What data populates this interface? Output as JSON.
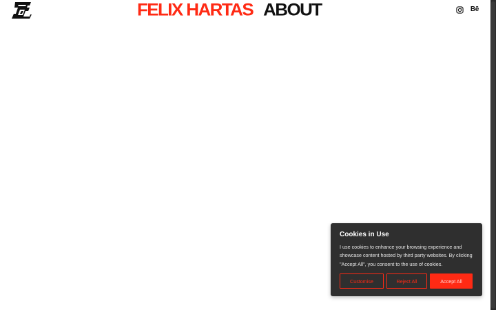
{
  "header": {
    "logo_icon": "fh-monogram-logo-icon",
    "nav": {
      "work_label": "FELIX HARTAS",
      "about_label": "ABOUT"
    },
    "social": {
      "instagram_icon": "instagram-icon",
      "behance_label": "Bē"
    }
  },
  "cookie_banner": {
    "title": "Cookies in Use",
    "body": "I use cookies to enhance your browsing experience and showcase content hosted by third party websites. By clicking \"Accept All\", you consent to the use of cookies.",
    "customise_label": "Customise",
    "reject_label": "Reject All",
    "accept_label": "Accept All"
  },
  "colors": {
    "accent": "#ff2a14",
    "text": "#111111",
    "banner_bg": "#2f2f2f",
    "page_bg": "#ffffff"
  }
}
